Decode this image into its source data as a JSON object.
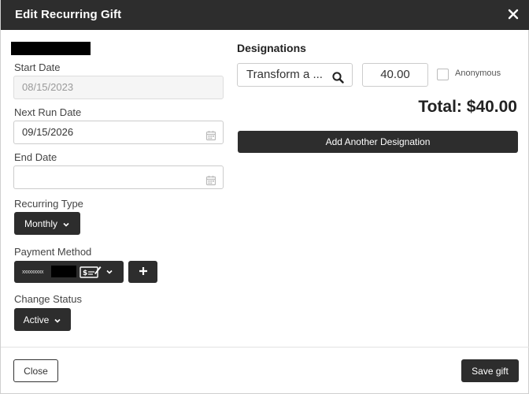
{
  "header": {
    "title": "Edit Recurring Gift"
  },
  "form": {
    "start_date": {
      "label": "Start Date",
      "value": "08/15/2023"
    },
    "next_run_date": {
      "label": "Next Run Date",
      "value": "09/15/2026"
    },
    "end_date": {
      "label": "End Date",
      "value": ""
    },
    "recurring_type": {
      "label": "Recurring Type",
      "value": "Monthly"
    },
    "payment_method": {
      "label": "Payment Method",
      "masked_number": "xxxxxxxxx"
    },
    "change_status": {
      "label": "Change Status",
      "value": "Active"
    }
  },
  "designations": {
    "title": "Designations",
    "item": {
      "name": "Transform a ...",
      "amount": "40.00",
      "anonymous_label": "Anonymous",
      "anonymous_checked": false
    },
    "total": "Total: $40.00",
    "add_button": "Add Another Designation"
  },
  "footer": {
    "close_label": "Close",
    "save_label": "Save gift"
  },
  "icons": {
    "close": "close-x-icon",
    "calendar": "calendar-icon",
    "search": "search-icon",
    "check": "check-payment-icon",
    "plus": "plus-icon",
    "chevron": "chevron-down-icon"
  },
  "colors": {
    "header_bg": "#2d2d2d",
    "button_bg": "#2d2d2d",
    "text": "#333333"
  }
}
